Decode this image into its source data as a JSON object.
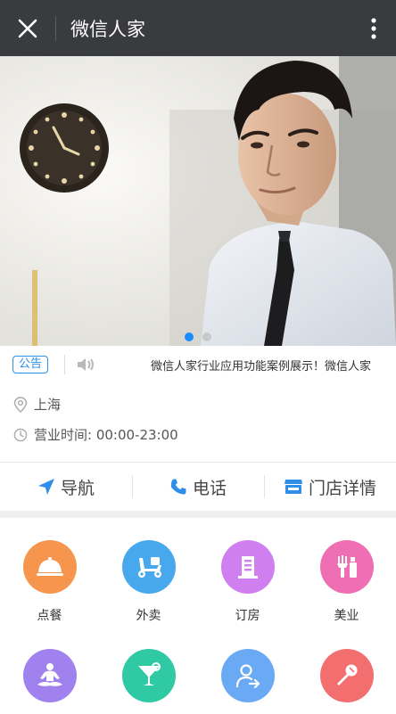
{
  "topbar": {
    "title": "微信人家",
    "close_icon": "close-icon",
    "more_icon": "more-vertical-icon"
  },
  "banner": {
    "slide_count": 2,
    "active_index": 0
  },
  "notice": {
    "tag": "公告",
    "text": "微信人家行业应用功能案例展示！微信人家"
  },
  "store": {
    "location": "上海",
    "hours": "营业时间: 00:00-23:00"
  },
  "actions": [
    {
      "label": "导航",
      "icon": "navigation-arrow-icon"
    },
    {
      "label": "电话",
      "icon": "phone-icon"
    },
    {
      "label": "门店详情",
      "icon": "store-icon"
    }
  ],
  "grid": [
    {
      "label": "点餐",
      "icon": "food-cloche-icon",
      "color": "#f7954f"
    },
    {
      "label": "外卖",
      "icon": "scooter-icon",
      "color": "#47a8ee"
    },
    {
      "label": "订房",
      "icon": "building-icon",
      "color": "#cf7ff0"
    },
    {
      "label": "美业",
      "icon": "cosmetics-icon",
      "color": "#ee6fb4"
    },
    {
      "label": "",
      "icon": "meditation-icon",
      "color": "#a082ef"
    },
    {
      "label": "",
      "icon": "cocktail-icon",
      "color": "#2fcaa4"
    },
    {
      "label": "",
      "icon": "user-transfer-icon",
      "color": "#6aaaf5"
    },
    {
      "label": "",
      "icon": "microphone-icon",
      "color": "#f36f6f"
    }
  ],
  "colors": {
    "topbar": "#3a3b3f",
    "accent": "#2a8fe6"
  }
}
